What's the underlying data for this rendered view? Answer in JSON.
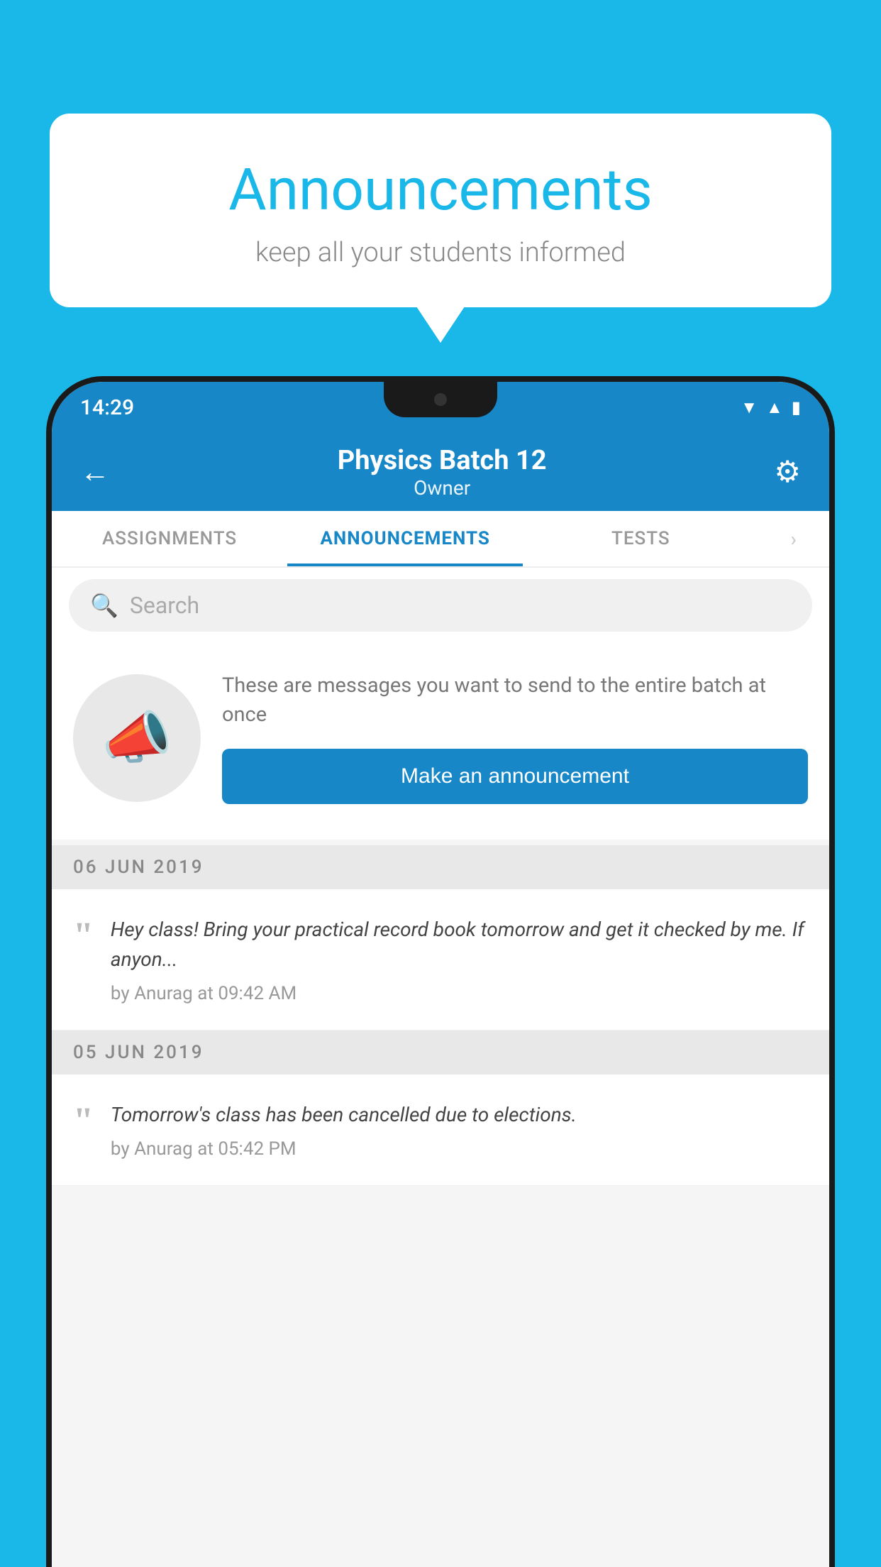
{
  "background": {
    "color": "#1ab8e8"
  },
  "speech_bubble": {
    "title": "Announcements",
    "subtitle": "keep all your students informed"
  },
  "status_bar": {
    "time": "14:29",
    "icons": [
      "wifi",
      "signal",
      "battery"
    ]
  },
  "header": {
    "title": "Physics Batch 12",
    "subtitle": "Owner",
    "back_label": "←",
    "gear_label": "⚙"
  },
  "tabs": [
    {
      "label": "ASSIGNMENTS",
      "active": false
    },
    {
      "label": "ANNOUNCEMENTS",
      "active": true
    },
    {
      "label": "TESTS",
      "active": false
    },
    {
      "label": "...",
      "active": false
    }
  ],
  "search": {
    "placeholder": "Search"
  },
  "announcement_prompt": {
    "message": "These are messages you want to send to the entire batch at once",
    "button_label": "Make an announcement"
  },
  "date_sections": [
    {
      "date": "06  JUN  2019",
      "announcements": [
        {
          "text": "Hey class! Bring your practical record book tomorrow and get it checked by me. If anyon...",
          "meta": "by Anurag at 09:42 AM"
        }
      ]
    },
    {
      "date": "05  JUN  2019",
      "announcements": [
        {
          "text": "Tomorrow's class has been cancelled due to elections.",
          "meta": "by Anurag at 05:42 PM"
        }
      ]
    }
  ]
}
